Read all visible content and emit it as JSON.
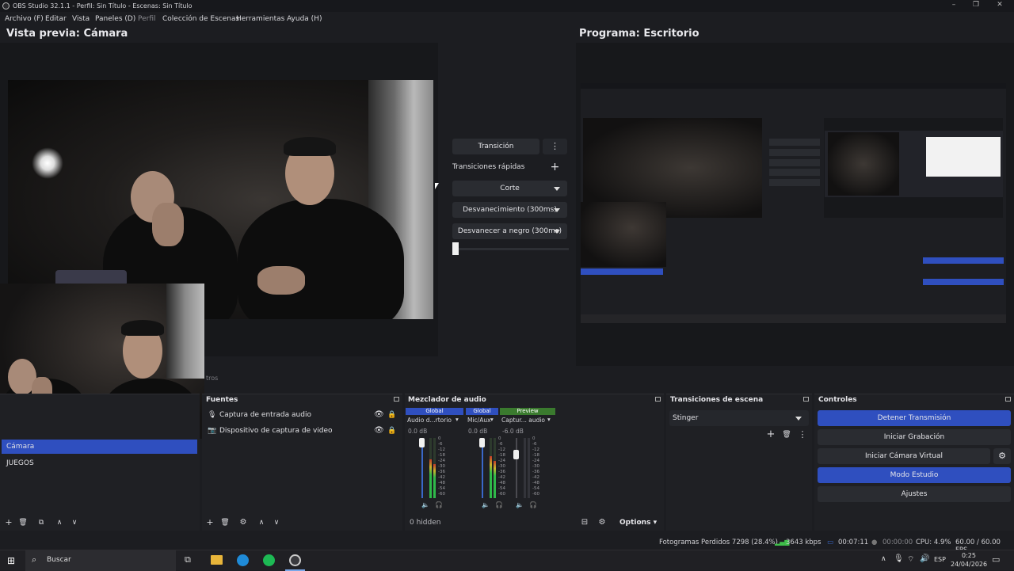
{
  "window": {
    "title": "OBS Studio 32.1.1 - Perfil: Sin Título - Escenas: Sin Título"
  },
  "menu": [
    "Archivo (F)",
    "Editar",
    "Vista",
    "Paneles (D)",
    "Perfil",
    "Colección de Escenas",
    "Herramientas",
    "Ayuda (H)"
  ],
  "preview": {
    "title": "Vista previa: Cámara"
  },
  "program": {
    "title": "Programa: Escritorio"
  },
  "transitions_panel": {
    "transition_label": "Transición",
    "quick_label": "Transiciones rápidas",
    "items": [
      "Corte",
      "Desvanecimiento (300ms)",
      "Desvanecer a negro (300ms)"
    ]
  },
  "scenes": {
    "items": [
      "Cámara",
      "JUEGOS"
    ],
    "selected": 0,
    "partial_label": "tros"
  },
  "sources": {
    "title": "Fuentes",
    "items": [
      {
        "name": "Captura de entrada audio",
        "icon": "microphone-icon"
      },
      {
        "name": "Dispositivo de captura de video",
        "icon": "camera-icon"
      }
    ]
  },
  "mixer": {
    "title": "Mezclador de audio",
    "channels": [
      {
        "tag": "Global",
        "tag_color": "#2f4fbf",
        "name": "Audio d...rtorio",
        "db": "0.0 dB",
        "level": 0.65
      },
      {
        "tag": "Global",
        "tag_color": "#2f4fbf",
        "name": "Mic/Aux",
        "db": "0.0 dB",
        "level": 0.7
      },
      {
        "tag": "Preview",
        "tag_color": "#3a7a2e",
        "name": "Captur... audio",
        "db": "-6.0 dB",
        "level": 0.0
      }
    ],
    "scale": [
      "0",
      "-6",
      "-12",
      "-18",
      "-24",
      "-30",
      "-36",
      "-42",
      "-48",
      "-54",
      "-60"
    ],
    "hidden": "0 hidden",
    "options": "Options"
  },
  "scene_transitions": {
    "title": "Transiciones de escena",
    "selected": "Stinger"
  },
  "controls": {
    "title": "Controles",
    "buttons": [
      "Detener Transmisión",
      "Iniciar Grabación",
      "Iniciar Cámara Virtual",
      "Modo Estudio",
      "Ajustes"
    ]
  },
  "status": {
    "dropped": "Fotogramas Perdidos 7298 (28.4%)",
    "bitrate": "3643 kbps",
    "stream_time": "00:07:11",
    "rec_time": "00:00:00",
    "cpu": "CPU: 4.9%",
    "fps": "60.00 / 60.00 FPS"
  },
  "taskbar": {
    "search": "Buscar",
    "lang": "ESP",
    "time": "0:25",
    "date": "24/04/2026"
  },
  "colors": {
    "accent": "#2f4fbf",
    "bg": "#1c1d21",
    "panel": "#1f2024"
  }
}
